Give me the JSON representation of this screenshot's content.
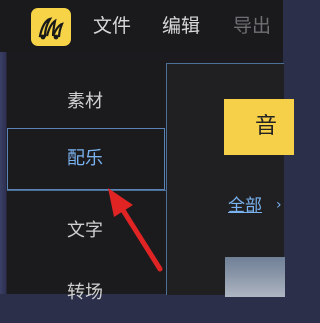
{
  "menubar": {
    "items": [
      {
        "label": "文件"
      },
      {
        "label": "编辑"
      },
      {
        "label": "导出"
      }
    ]
  },
  "sidebar": {
    "items": [
      {
        "label": "素材"
      },
      {
        "label": "配乐"
      },
      {
        "label": "文字"
      },
      {
        "label": "转场"
      }
    ]
  },
  "content": {
    "tab_label": "音",
    "filter_label": "全部"
  },
  "colors": {
    "accent_blue": "#7ab2f0",
    "logo_yellow": "#f7d348",
    "annotation_red": "#e02424"
  }
}
